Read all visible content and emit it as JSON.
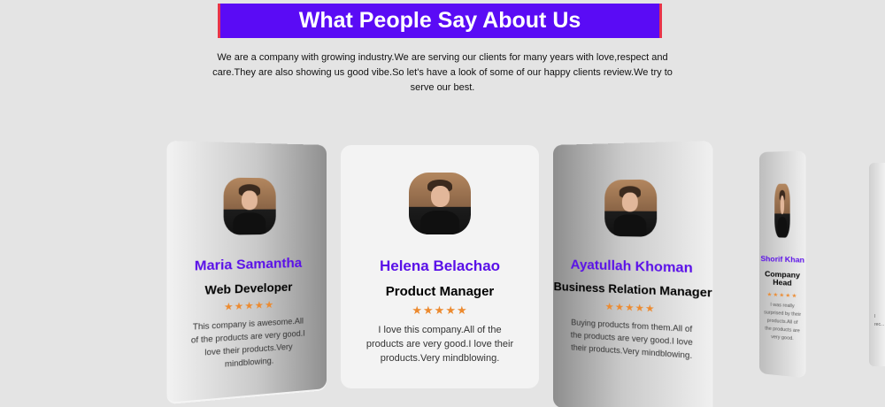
{
  "header": {
    "title": "What People Say About Us",
    "intro": "We are a company with growing industry.We are serving our clients for many years with love,respect and care.They are also showing us good vibe.So let's have a look of some of our happy clients review.We try to serve our best."
  },
  "colors": {
    "title_bg": "#5a0bf5",
    "title_border": "#e8344a",
    "name": "#5a10e8",
    "stars": "#ec8a2f"
  },
  "testimonials": [
    {
      "name": "Maria Samantha",
      "role": "Web Developer",
      "stars": "★★★★★",
      "quote": "This company is awesome.All of the products are very good.I love their products.Very mindblowing."
    },
    {
      "name": "Helena Belachao",
      "role": "Product Manager",
      "stars": "★★★★★",
      "quote": "I love this company.All of the products are very good.I love their products.Very mindblowing."
    },
    {
      "name": "Ayatullah Khoman",
      "role": "Business Relation Manager",
      "stars": "★★★★★",
      "quote": "Buying products from them.All of the products are very good.I love their products.Very mindblowing."
    },
    {
      "name": "Shorif Khan",
      "role": "Company Head",
      "stars": "★★★★★",
      "quote": "I was really surprised by their products.All of the products are very good."
    },
    {
      "quote": "I rec..."
    }
  ]
}
